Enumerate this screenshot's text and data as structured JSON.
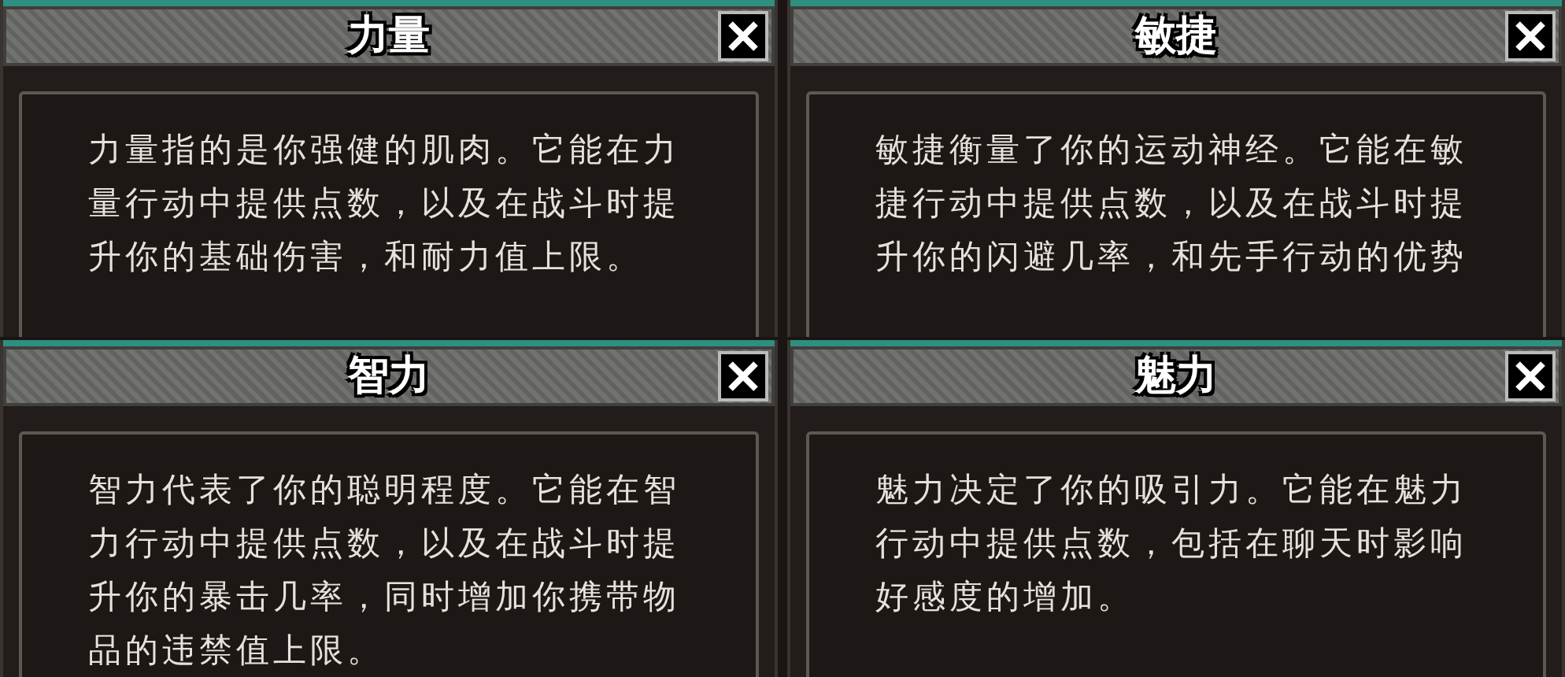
{
  "panels": [
    {
      "title": "力量",
      "lines": [
        "力量指的是你强健的肌肉。它能在力",
        "量行动中提供点数，以及在战斗时提",
        "升你的基础伤害，和耐力值上限。"
      ]
    },
    {
      "title": "敏捷",
      "lines": [
        "敏捷衡量了你的运动神经。它能在敏",
        "捷行动中提供点数，以及在战斗时提",
        "升你的闪避几率，和先手行动的优势"
      ]
    },
    {
      "title": "智力",
      "lines": [
        "智力代表了你的聪明程度。它能在智",
        "力行动中提供点数，以及在战斗时提",
        "升你的暴击几率，同时增加你携带物",
        "品的违禁值上限。"
      ]
    },
    {
      "title": "魅力",
      "lines": [
        "魅力决定了你的吸引力。它能在魅力",
        "行动中提供点数，包括在聊天时影响",
        "好感度的增加。"
      ]
    }
  ]
}
